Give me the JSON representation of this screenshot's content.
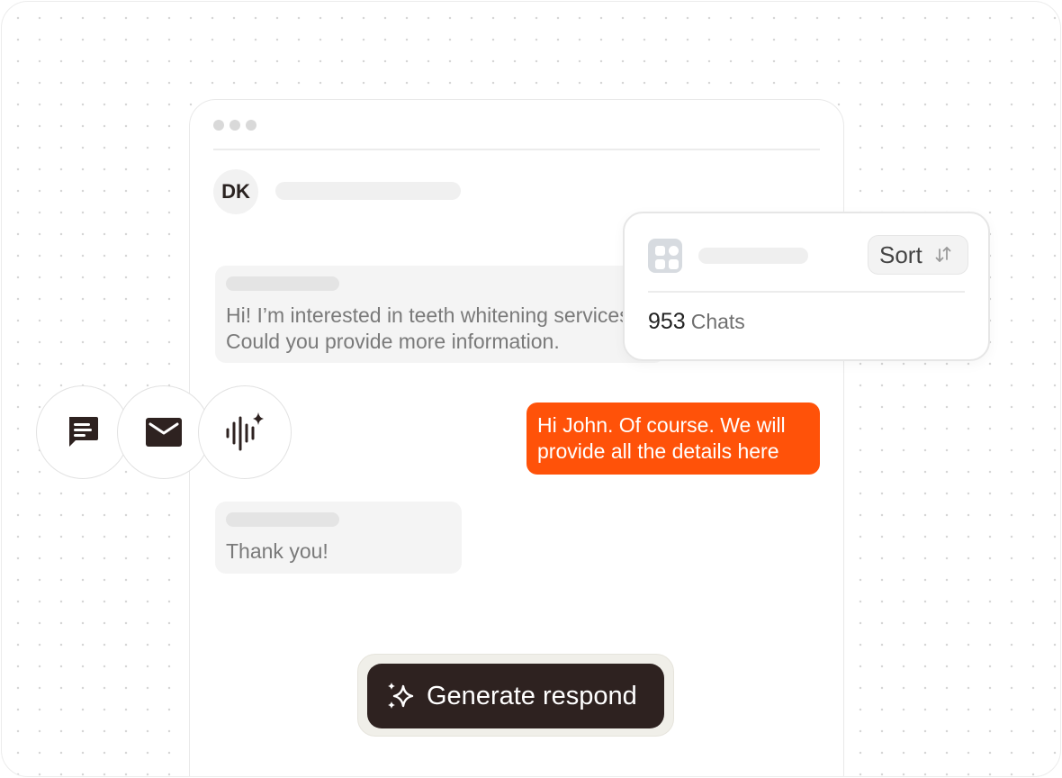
{
  "chat": {
    "avatar_initials": "DK",
    "messages": [
      {
        "from": "customer",
        "line1": "Hi! I’m interested in teeth whitening services.",
        "line2": "Could you provide more information."
      },
      {
        "from": "agent",
        "line1": "Hi John. Of course. We will",
        "line2": "provide all the details here"
      },
      {
        "from": "customer",
        "line1": "Thank you!"
      }
    ]
  },
  "panel": {
    "sort_label": "Sort",
    "count_value": "953",
    "count_label": "Chats"
  },
  "channels": [
    {
      "icon": "chat-icon"
    },
    {
      "icon": "mail-icon"
    },
    {
      "icon": "voice-ai-icon"
    }
  ],
  "action": {
    "generate_label": "Generate respond"
  },
  "colors": {
    "accent": "#ff5209",
    "dark": "#2e2220",
    "bubble": "#f4f4f4"
  }
}
